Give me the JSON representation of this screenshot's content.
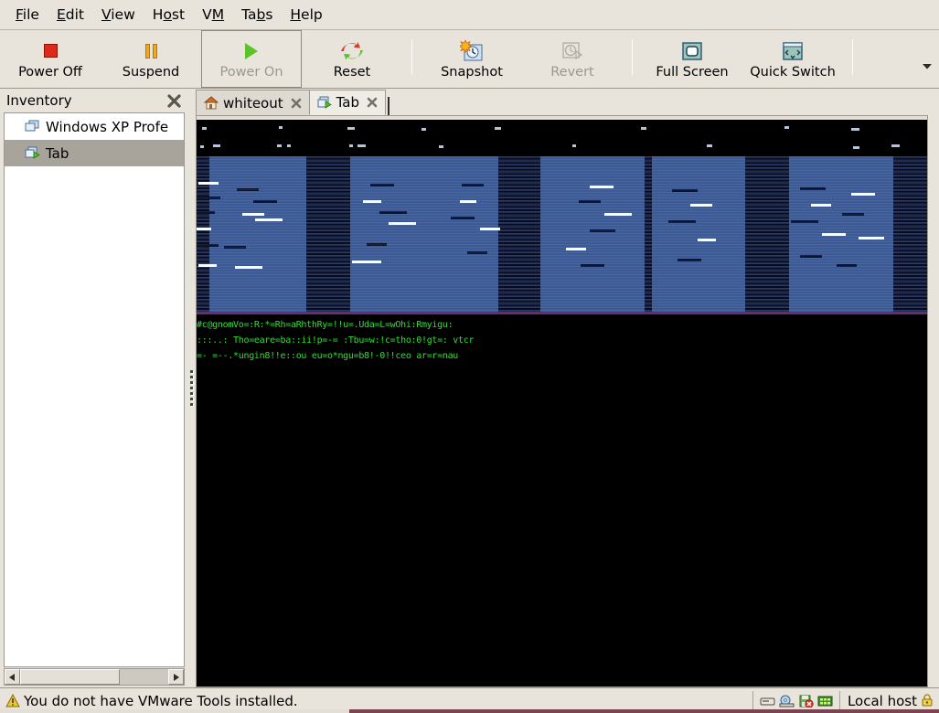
{
  "menubar": {
    "items": [
      {
        "label": "File",
        "mnemonic": "F"
      },
      {
        "label": "Edit",
        "mnemonic": "E"
      },
      {
        "label": "View",
        "mnemonic": "V"
      },
      {
        "label": "Host",
        "mnemonic": "o"
      },
      {
        "label": "VM",
        "mnemonic": "M"
      },
      {
        "label": "Tabs",
        "mnemonic": "b"
      },
      {
        "label": "Help",
        "mnemonic": "H"
      }
    ]
  },
  "toolbar": {
    "buttons": [
      {
        "label": "Power Off",
        "icon": "stop-square-icon",
        "enabled": true,
        "boxed": false
      },
      {
        "label": "Suspend",
        "icon": "pause-bars-icon",
        "enabled": true,
        "boxed": false
      },
      {
        "label": "Power On",
        "icon": "play-triangle-icon",
        "enabled": false,
        "boxed": true
      },
      {
        "label": "Reset",
        "icon": "reset-arrows-icon",
        "enabled": true,
        "boxed": false
      },
      {
        "label": "Snapshot",
        "icon": "snapshot-clock-icon",
        "enabled": true,
        "boxed": false
      },
      {
        "label": "Revert",
        "icon": "revert-clock-icon",
        "enabled": false,
        "boxed": false
      },
      {
        "label": "Full Screen",
        "icon": "fullscreen-icon",
        "enabled": true,
        "boxed": false
      },
      {
        "label": "Quick Switch",
        "icon": "quick-switch-icon",
        "enabled": true,
        "boxed": false
      }
    ],
    "overflow_icon": "chevron-down-icon"
  },
  "sidebar": {
    "title": "Inventory",
    "close_icon": "close-icon",
    "items": [
      {
        "label": "Windows XP Profe",
        "icon": "vm-icon",
        "selected": false,
        "running": false
      },
      {
        "label": "Tab",
        "icon": "vm-running-icon",
        "selected": true,
        "running": true
      }
    ],
    "scrollbar": {
      "left_icon": "arrow-left-icon",
      "right_icon": "arrow-right-icon",
      "thumb_percent": 67
    }
  },
  "tabs": [
    {
      "label": "whiteout",
      "icon": "home-icon",
      "close_icon": "close-icon",
      "active": false
    },
    {
      "label": "Tab",
      "icon": "vm-running-icon",
      "close_icon": "close-icon",
      "active": true
    }
  ],
  "console": {
    "description": "Corrupted VM guest display: black background with blue banded graphics and garbled green text",
    "colors": {
      "background": "#000000",
      "blue_block": "#3c5a96",
      "dark_column": "#0d1330",
      "green_text": "#2ee02e",
      "magenta_line": "#6a2a7a",
      "glitch_light": "#c9d7ef"
    },
    "garbled_lines": [
      "#c@gnomVo=:R:*=Rh=aRhthRy=!!u=.Uda=L=wOhi:Rmyigu:",
      ":::..: Tho=eare=ba::ii!p=-= :Tbu=w:!c=tho:0!gt=: vtcr",
      "=-  =--.*ungin8!!e::ou  eu=o*ngu=b8!-0!!ceo  ar=r=nau"
    ]
  },
  "statusbar": {
    "warning_icon": "warning-triangle-icon",
    "message": "You do not have VMware Tools installed.",
    "device_icons": [
      "hard-disk-icon",
      "cdrom-icon",
      "floppy-disconnected-icon",
      "network-icon"
    ],
    "host_label": "Local host",
    "host_icon": "lock-icon"
  }
}
